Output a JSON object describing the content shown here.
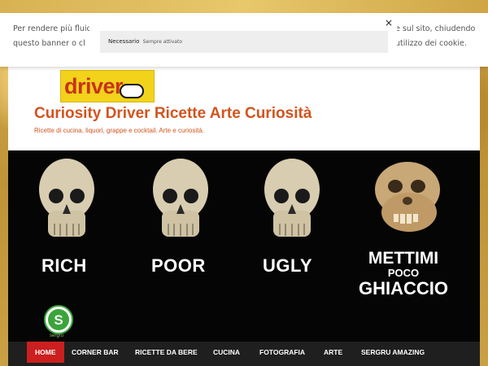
{
  "cookie_banner": {
    "text_left": "Per rendere più fluid questo banner o cl",
    "text_right": "e sul sito, chiudendo utilizzo dei cookie.",
    "close_icon": "×",
    "category": {
      "label": "Necessario",
      "status": "Sempre attivato"
    }
  },
  "site": {
    "logo_text": "driver",
    "title": "Curiosity Driver Ricette Arte Curiosità",
    "description": "Ricette di cucina, liquori, grappe e cocktail. Arte e curiosità.",
    "brand_color": "#d2541e"
  },
  "hero": {
    "words": [
      "RICH",
      "POOR",
      "UGLY"
    ],
    "caption_lines": [
      "METTIMI",
      "POCO",
      "GHIACCIO"
    ],
    "badge_letter": "S",
    "badge_label": "sergru"
  },
  "nav": {
    "active_color": "#cc1f1f",
    "items": [
      {
        "label": "HOME",
        "active": true
      },
      {
        "label": "CORNER BAR",
        "active": false
      },
      {
        "label": "RICETTE DA BERE",
        "active": false
      },
      {
        "label": "CUCINA",
        "active": false
      },
      {
        "label": "FOTOGRAFIA",
        "active": false
      },
      {
        "label": "ARTE",
        "active": false
      },
      {
        "label": "SERGRU AMAZING",
        "active": false
      }
    ]
  }
}
